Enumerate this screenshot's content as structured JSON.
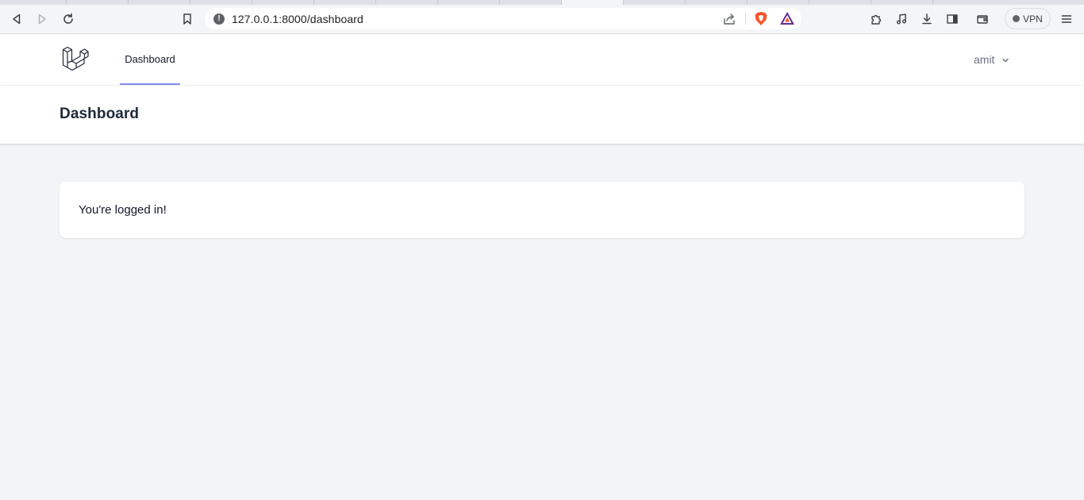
{
  "browser": {
    "url": "127.0.0.1:8000/dashboard",
    "vpn_label": "VPN",
    "icons": [
      "back-icon",
      "forward-icon",
      "reload-icon",
      "bookmark-icon",
      "site-info-icon",
      "share-icon",
      "brave-shields-icon",
      "brave-rewards-icon",
      "extensions-icon",
      "media-icon",
      "downloads-icon",
      "sidebar-icon",
      "wallet-icon",
      "menu-icon"
    ]
  },
  "nav": {
    "links": [
      {
        "label": "Dashboard",
        "active": true
      }
    ],
    "user_name": "amit"
  },
  "header": {
    "title": "Dashboard"
  },
  "main": {
    "message": "You're logged in!"
  },
  "colors": {
    "active_underline": "#818cf8",
    "page_bg": "#f3f4f6"
  }
}
